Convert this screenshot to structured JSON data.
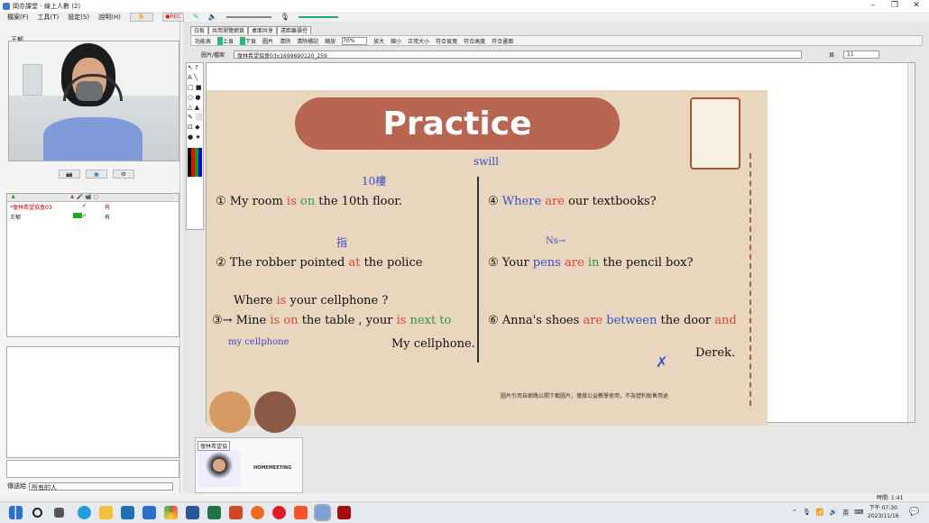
{
  "window": {
    "title": "岡亦課堂 - 線上人數 (2)"
  },
  "menu": {
    "file": "檔案(F)",
    "tools": "工具(T)",
    "settings": "設定(S)",
    "help": "說明(H)",
    "rec": "●REC"
  },
  "tabs": [
    "白板",
    "共用瀏覽網頁",
    "桌面共享",
    "遠距離操控"
  ],
  "toolbar": {
    "func": "功能表",
    "prev": "上頁",
    "next": "下頁",
    "pic": "圖片",
    "clear": "清除",
    "clearmark": "清除標記",
    "zoomlabel": "縮放",
    "zoom": "70%",
    "zoomin": "放大",
    "zoomout": "縮小",
    "normal": "正常大小",
    "fitpage": "符合頁寬",
    "fitheight": "符合高度",
    "fitscreen": "符合畫面"
  },
  "pathbar": {
    "label": "圖片/檔案",
    "file": "復林希望協會03x1699690120_259",
    "page_label": "頁",
    "page": "11"
  },
  "webcam": {
    "name": "王郁"
  },
  "userlist": [
    {
      "name": "*復林希望協會03",
      "status": "有"
    },
    {
      "name": "王郁",
      "status": "有"
    }
  ],
  "chat": {
    "label": "傳送給",
    "target": "所有的人"
  },
  "thumb": {
    "name": "復林希望協",
    "logo": "HOMEMEETING"
  },
  "slide": {
    "title": "Practice",
    "q1": "① My room",
    "q1_is": "is",
    "q1_on": "on",
    "q1_rest": "the 10th floor.",
    "q1_note": "10樓",
    "q2": "② The robber pointed",
    "q2_at": "at",
    "q2_rest": "the police",
    "q2_note": "指",
    "q3a": "Where",
    "q3a_is": "is",
    "q3a_rest": "your cellphone ?",
    "q3b": "③→ Mine",
    "q3b_is": "is",
    "q3b_on": "on",
    "q3b_mid": "the table , your",
    "q3b_is2": "is",
    "q3b_next": "next to",
    "q3c": "my cellphone",
    "q3d": "My cellphone.",
    "q4": "④",
    "q4_where": "Where",
    "q4_are": "are",
    "q4_rest": "our textbooks?",
    "q4_note": "swill",
    "q5": "⑤ Your",
    "q5_pens": "pens",
    "q5_are": "are",
    "q5_in": "in",
    "q5_rest": "the pencil box?",
    "q5_note": "Ns→",
    "q6": "⑥ Anna's shoes",
    "q6_are": "are",
    "q6_between": "between",
    "q6_rest": "the door",
    "q6_and": "and",
    "q6_derek": "Derek.",
    "footnote": "圖片引用自網路公開下載圖片，僅做公益教學使用，不為營利販售用途"
  },
  "status": {
    "time_label": "時間: 1:41",
    "clock": "下午 07:30",
    "date": "2023/11/16",
    "ime": "英"
  }
}
